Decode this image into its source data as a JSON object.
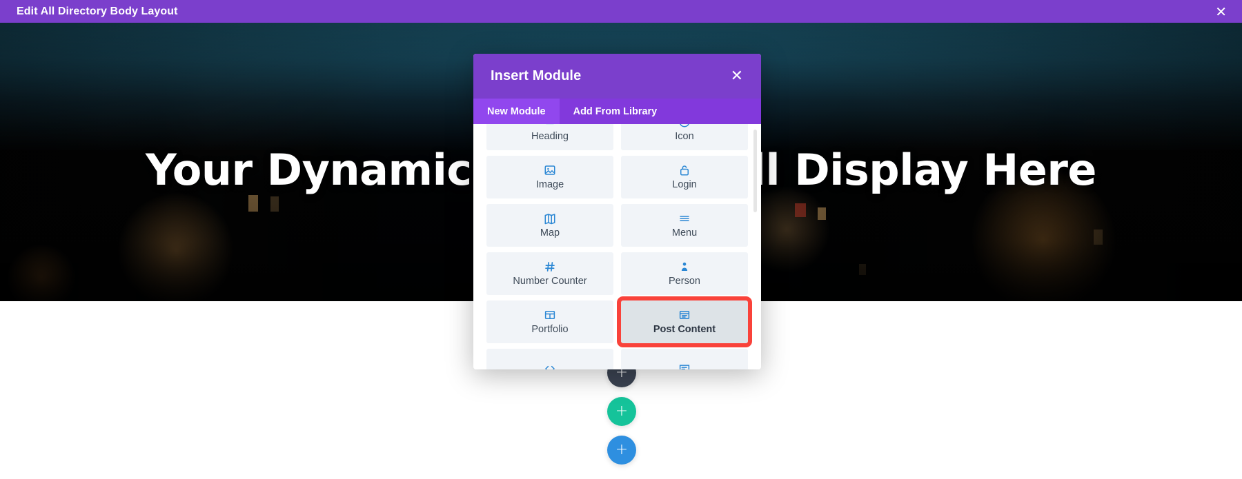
{
  "topbar": {
    "title": "Edit All Directory Body Layout",
    "close_label": "✕"
  },
  "hero": {
    "headline": "Your Dynamic Content Will Display Here"
  },
  "modal": {
    "title": "Insert Module",
    "close_label": "✕",
    "tabs": [
      {
        "label": "New Module",
        "active": true
      },
      {
        "label": "Add From Library",
        "active": false
      }
    ],
    "modules": [
      {
        "label": "Heading",
        "icon": "heading-icon",
        "selected": false
      },
      {
        "label": "Icon",
        "icon": "icon-circle-icon",
        "selected": false
      },
      {
        "label": "Image",
        "icon": "image-icon",
        "selected": false
      },
      {
        "label": "Login",
        "icon": "lock-icon",
        "selected": false
      },
      {
        "label": "Map",
        "icon": "map-icon",
        "selected": false
      },
      {
        "label": "Menu",
        "icon": "hamburger-menu-icon",
        "selected": false
      },
      {
        "label": "Number Counter",
        "icon": "hash-icon",
        "selected": false
      },
      {
        "label": "Person",
        "icon": "person-icon",
        "selected": false
      },
      {
        "label": "Portfolio",
        "icon": "grid-icon",
        "selected": true
      },
      {
        "label": "Post Content",
        "icon": "post-content-icon",
        "selected": false
      },
      {
        "label": "",
        "icon": "code-icon",
        "selected": false
      },
      {
        "label": "",
        "icon": "comment-icon",
        "selected": false
      }
    ],
    "selected_module": "Post Content"
  },
  "builder_buttons": [
    {
      "name": "gray-action-button",
      "label": "+",
      "color": "#3b4352"
    },
    {
      "name": "add-row-button",
      "label": "+",
      "color": "#15c39a"
    },
    {
      "name": "add-section-button",
      "label": "+",
      "color": "#2e8fe0"
    }
  ],
  "colors": {
    "brand_purple": "#7B3FCC",
    "tab_active": "#9147EE",
    "tab_inactive": "#8239DC",
    "highlight_red": "#f9423a",
    "icon_blue": "#2b87d4",
    "green": "#15c39a",
    "blue": "#2e8fe0"
  }
}
